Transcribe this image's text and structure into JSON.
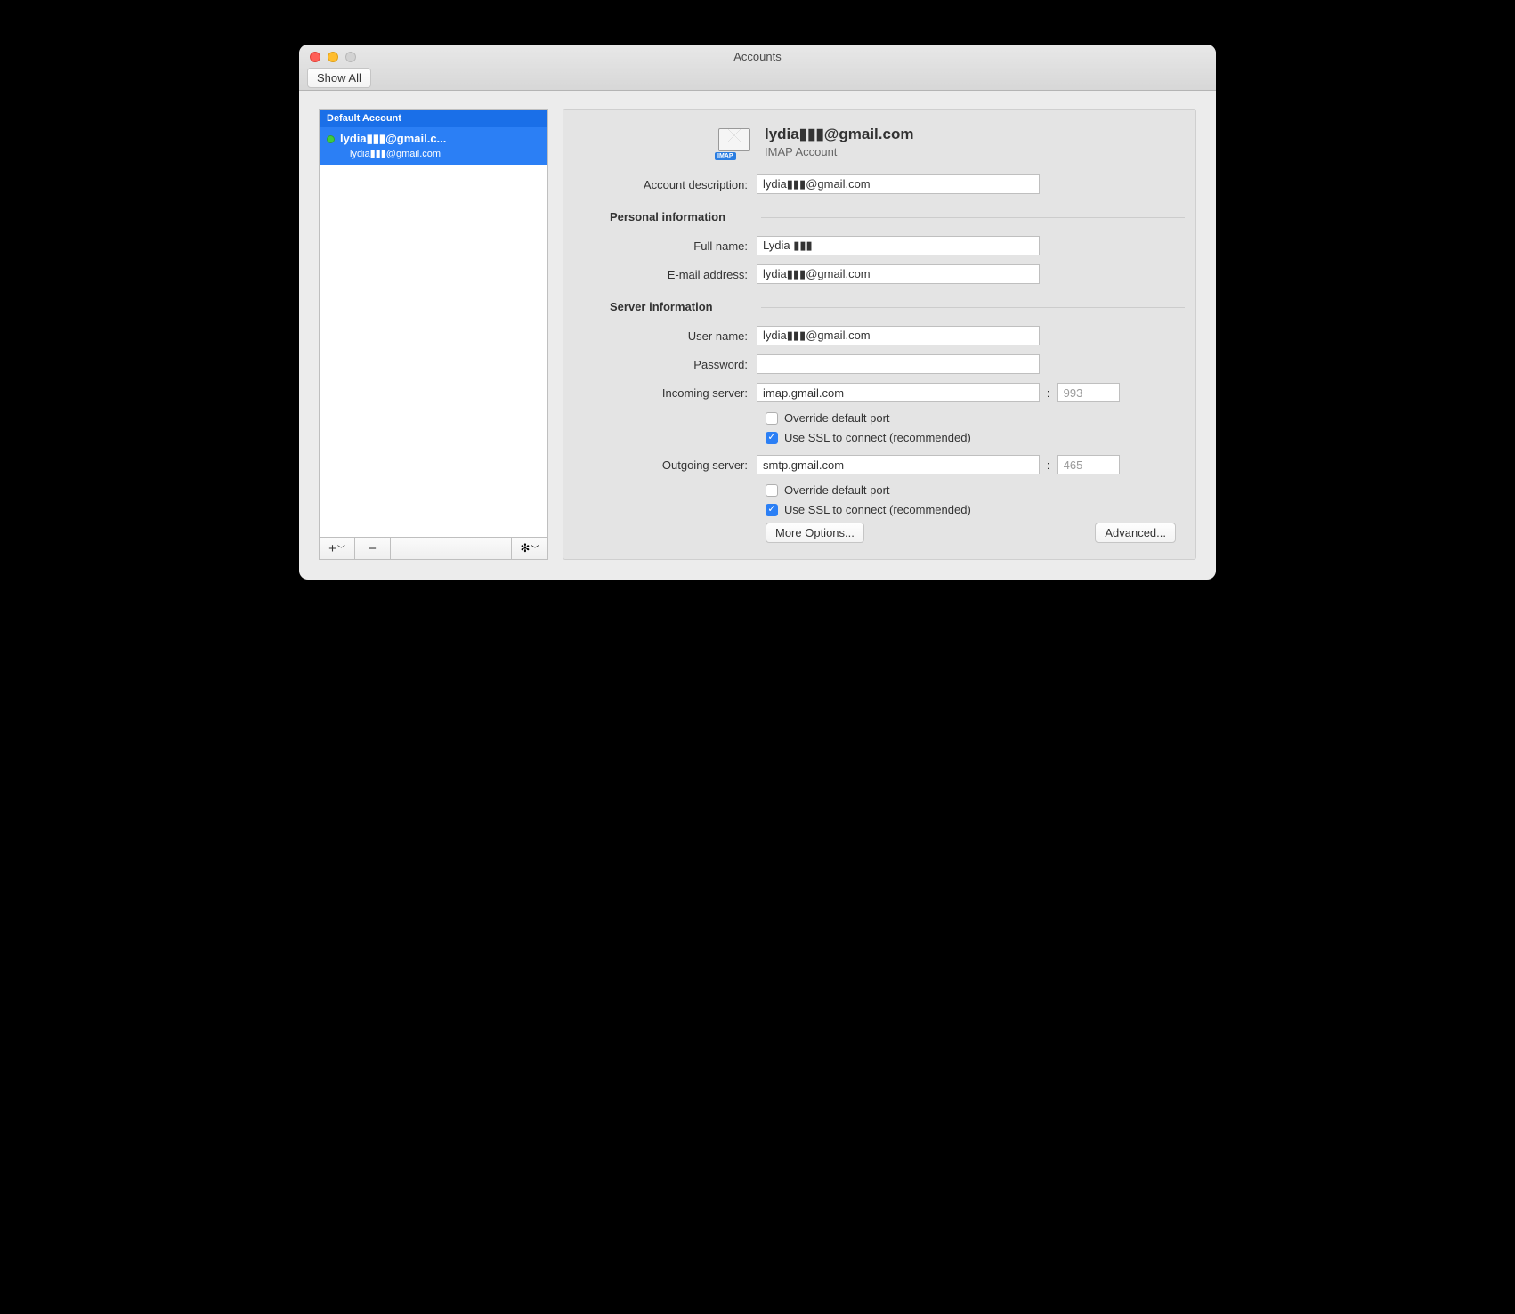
{
  "window": {
    "title": "Accounts",
    "show_all": "Show All"
  },
  "sidebar": {
    "header": "Default Account",
    "item": {
      "title": "lydia▮▮▮@gmail.c...",
      "sub": "lydia▮▮▮@gmail.com"
    }
  },
  "header": {
    "email": "lydia▮▮▮@gmail.com",
    "type": "IMAP Account",
    "imap_badge": "IMAP"
  },
  "labels": {
    "desc": "Account description:",
    "personal": "Personal information",
    "fullname": "Full name:",
    "email": "E-mail address:",
    "server": "Server information",
    "username": "User name:",
    "password": "Password:",
    "incoming": "Incoming server:",
    "outgoing": "Outgoing server:",
    "override": "Override default port",
    "ssl": "Use SSL to connect (recommended)",
    "more": "More Options...",
    "advanced": "Advanced..."
  },
  "values": {
    "desc": "lydia▮▮▮@gmail.com",
    "fullname": "Lydia ▮▮▮",
    "email": "lydia▮▮▮@gmail.com",
    "username": "lydia▮▮▮@gmail.com",
    "password": "",
    "incoming_server": "imap.gmail.com",
    "incoming_port": "993",
    "outgoing_server": "smtp.gmail.com",
    "outgoing_port": "465"
  },
  "checks": {
    "incoming_override": false,
    "incoming_ssl": true,
    "outgoing_override": false,
    "outgoing_ssl": true
  }
}
